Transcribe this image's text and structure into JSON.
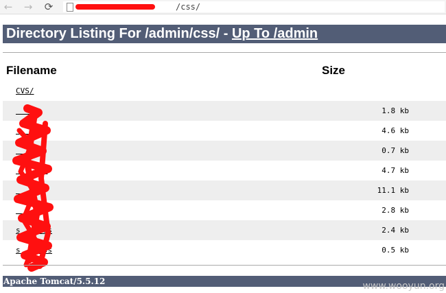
{
  "browser": {
    "back_glyph": "←",
    "forward_glyph": "→",
    "reload_glyph": "⟳",
    "url_visible": "/css/"
  },
  "header": {
    "title": "Directory Listing For /admin/css/ - ",
    "up_link": "Up To /admin"
  },
  "table": {
    "columns": [
      "Filename",
      "Size"
    ],
    "rows": [
      {
        "name": "CVS/",
        "size": ""
      },
      {
        "name": "    s",
        "size": "1.8 kb"
      },
      {
        "name": "    s",
        "size": "4.6 kb"
      },
      {
        "name": "     s",
        "size": "0.7 kb"
      },
      {
        "name": "     ss",
        "size": "4.7 kb"
      },
      {
        "name": "     s",
        "size": "11.1 kb"
      },
      {
        "name": "     ss",
        "size": "2.8 kb"
      },
      {
        "name": "s     ss",
        "size": "2.4 kb"
      },
      {
        "name": "s     ss",
        "size": "0.5 kb"
      }
    ]
  },
  "footer": {
    "server": "Apache Tomcat/5.5.12"
  },
  "watermark": "www.wooyun.org",
  "colors": {
    "header_bg": "#525d76",
    "row_shade": "#eeeeee",
    "redaction": "#ff1010"
  }
}
